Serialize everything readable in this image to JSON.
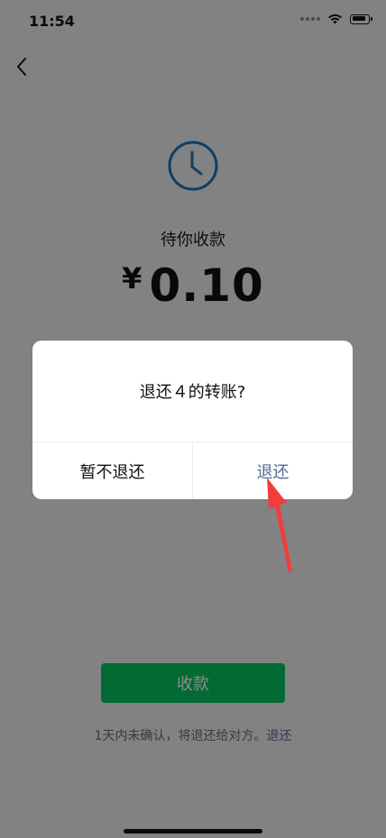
{
  "status_bar": {
    "time": "11:54"
  },
  "transfer": {
    "status_label": "待你收款",
    "currency": "¥",
    "amount": "0.10",
    "receive_button": "收款",
    "note_text": "1天内未确认，将退还给对方。",
    "note_link": "退还"
  },
  "dialog": {
    "title": "退还４的转账?",
    "cancel_label": "暂不退还",
    "confirm_label": "退还"
  },
  "colors": {
    "accent_green": "#07c160",
    "link_blue": "#576b95",
    "annotation_red": "#f23d3d",
    "clock_blue": "#1f6fb2"
  }
}
